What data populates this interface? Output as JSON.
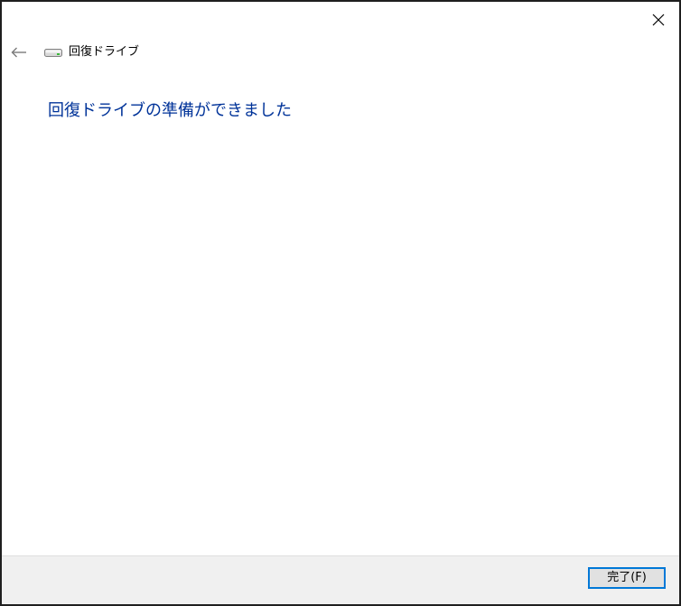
{
  "header": {
    "title": "回復ドライブ"
  },
  "main": {
    "heading": "回復ドライブの準備ができました"
  },
  "footer": {
    "finish_label": "完了(F)"
  },
  "icons": {
    "close": "close-icon",
    "back": "back-arrow-icon",
    "drive": "drive-icon"
  },
  "colors": {
    "heading": "#003399",
    "button_border": "#0078d7",
    "footer_bg": "#f0f0f0"
  }
}
